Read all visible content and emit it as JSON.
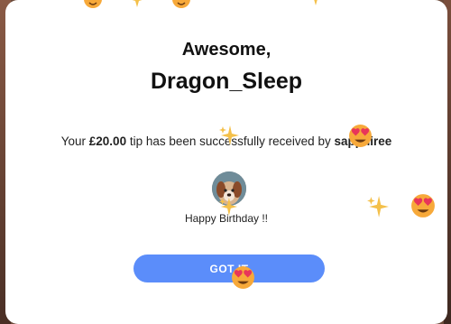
{
  "modal": {
    "greeting": "Awesome,",
    "username": "Dragon_Sleep",
    "message": {
      "prefix": "Your ",
      "amount": "£20.00",
      "middle": " tip has been successfully received by ",
      "recipient": "sapphiree"
    },
    "note": "Happy Birthday !!",
    "button_label": "GOT IT"
  },
  "colors": {
    "button": "#5b8dfa",
    "sparkle": "#f4c04a",
    "emoji_face": "#f7a93a",
    "heart": "#e8355a"
  },
  "decorations": {
    "floating_icons": [
      "sparkles-icon",
      "heart-eyes-emoji-icon"
    ]
  }
}
